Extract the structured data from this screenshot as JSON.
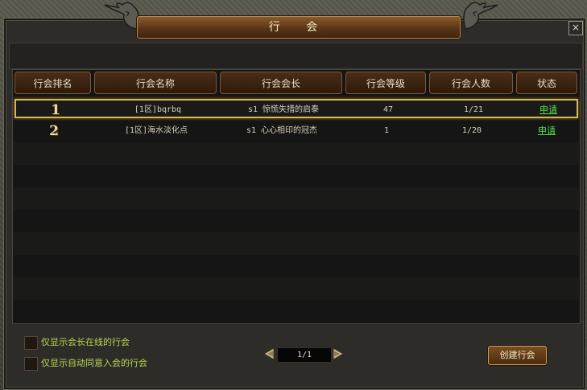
{
  "window": {
    "title": "行 会",
    "close_label": "×"
  },
  "table": {
    "columns": [
      "行会排名",
      "行会名称",
      "行会会长",
      "行会等级",
      "行会人数",
      "状态"
    ],
    "rows": [
      {
        "rank": "1",
        "name": "[1区]bqrbq",
        "leader": "s1 惊慌失措的启泰",
        "level": "47",
        "members": "1/21",
        "status": "申请",
        "selected": true
      },
      {
        "rank": "2",
        "name": "[1区]海水淡化点",
        "leader": "s1 心心相印的冠杰",
        "level": "1",
        "members": "1/20",
        "status": "申请",
        "selected": false
      }
    ]
  },
  "filters": {
    "leader_online": "仅显示会长在线的行会",
    "auto_accept": "仅显示自动同意入会的行会"
  },
  "pager": {
    "page": "1/1"
  },
  "create_button": "创建行会",
  "colors": {
    "accent_gold": "#d8b357",
    "link_green": "#54e24b",
    "checkbox_label": "#b7d654"
  }
}
